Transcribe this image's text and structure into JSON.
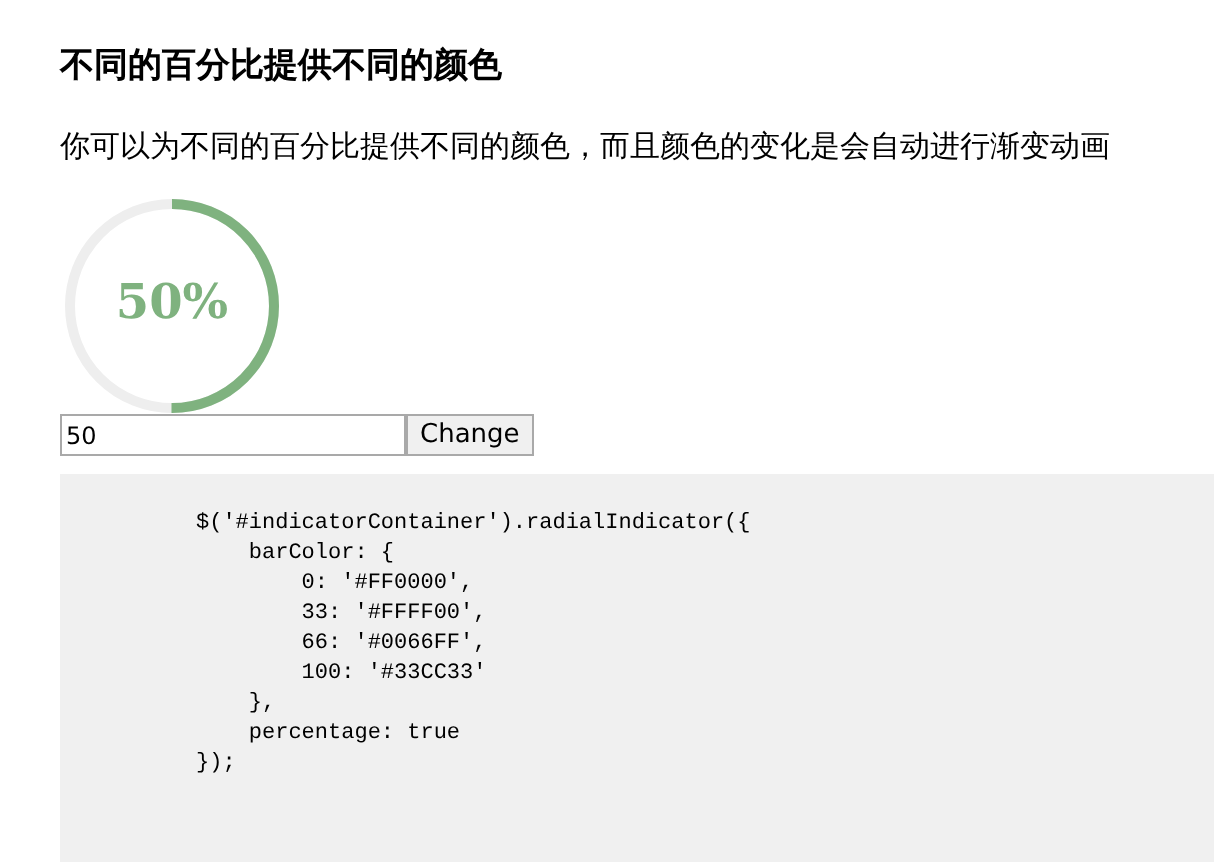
{
  "heading": "不同的百分比提供不同的颜色",
  "description": "你可以为不同的百分比提供不同的颜色，而且颜色的变化是会自动进行渐变动画",
  "indicator": {
    "level": 0.5,
    "reading": "50%",
    "color": "#7fb27f"
  },
  "input": {
    "value": "50"
  },
  "button": "Change",
  "code": "$('#indicatorContainer').radialIndicator({\n    barColor: {\n        0: '#FF0000',\n        33: '#FFFF00',\n        66: '#0066FF',\n        100: '#33CC33'\n    },\n    percentage: true\n});"
}
